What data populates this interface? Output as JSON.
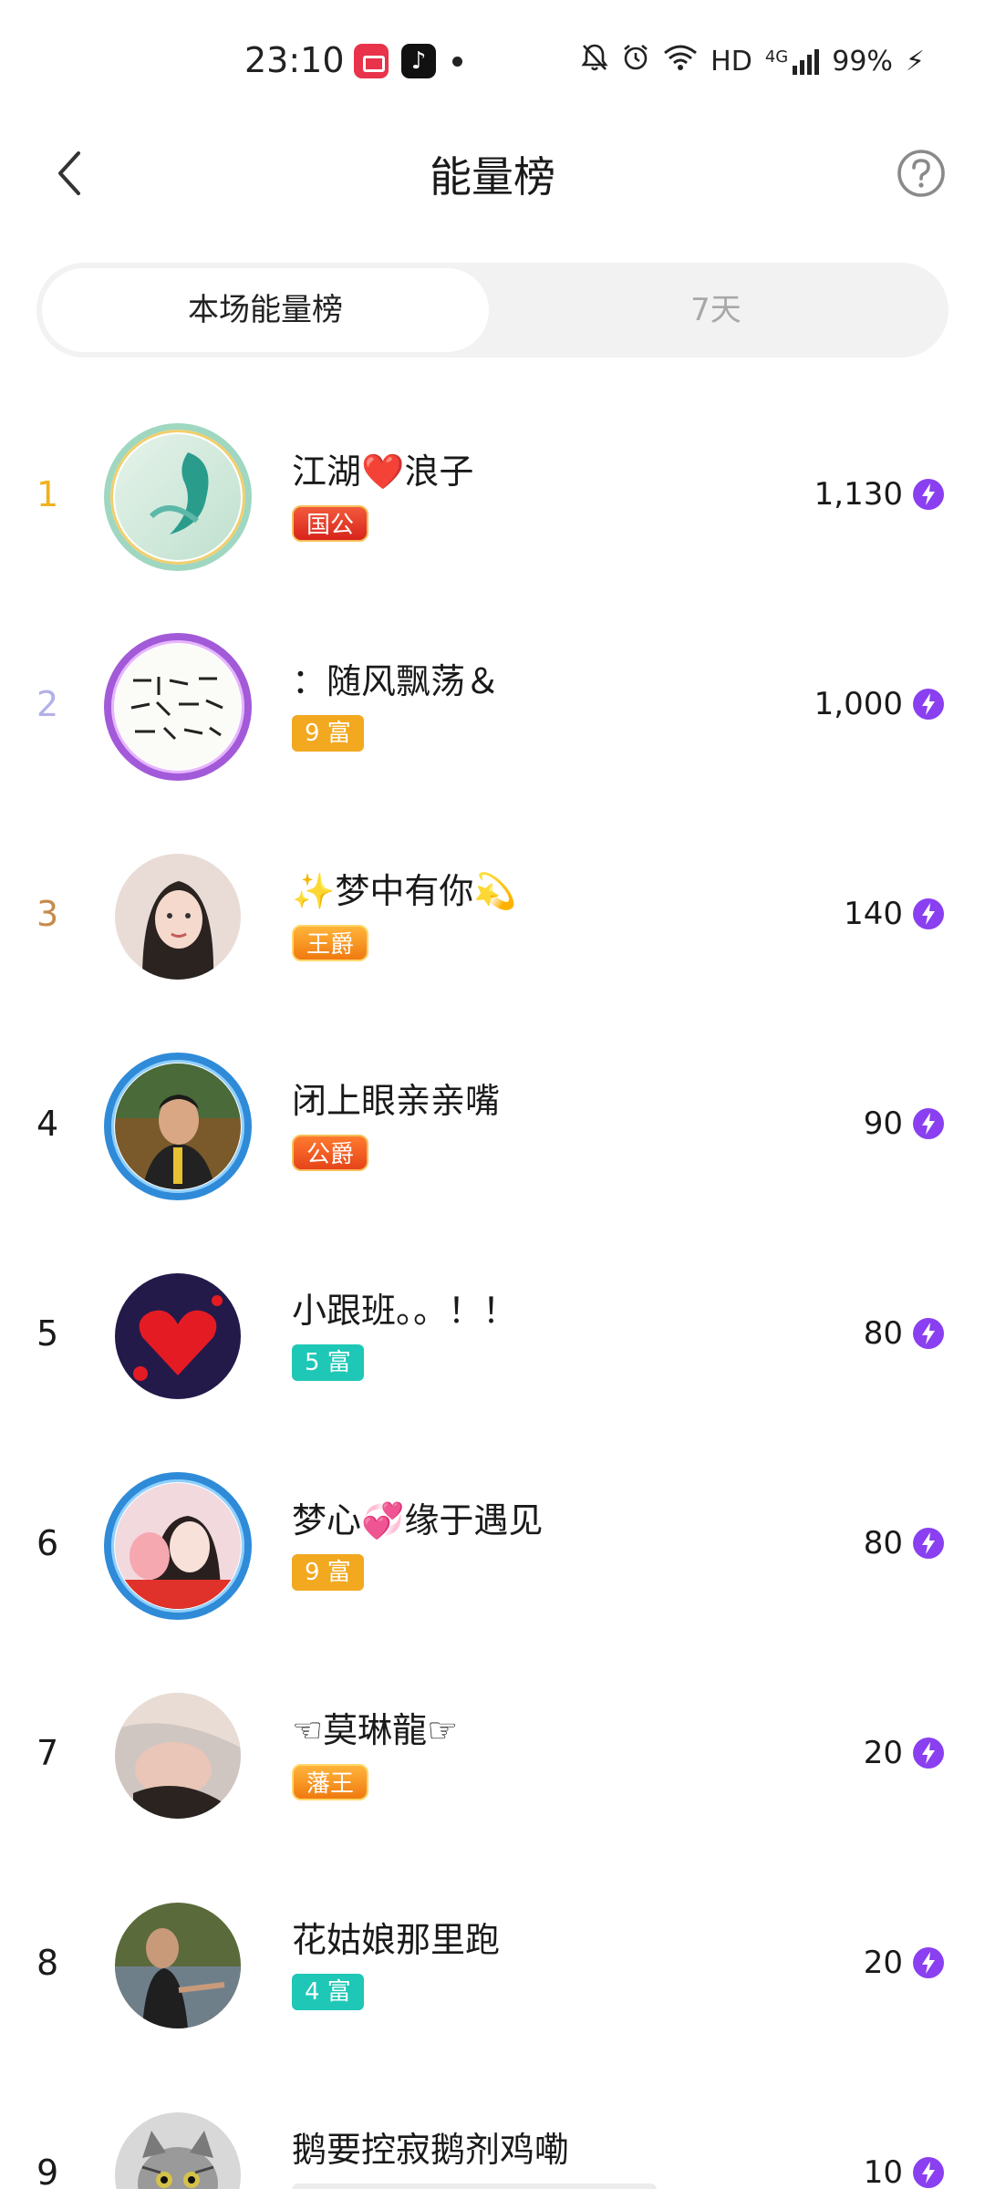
{
  "status_bar": {
    "time": "23:10",
    "network": "HD",
    "signal_label": "4G",
    "battery": "99%",
    "icons": [
      "screen-record-icon",
      "tiktok-icon",
      "notification-dot-icon",
      "mute-icon",
      "alarm-icon",
      "wifi-icon",
      "signal-icon",
      "charging-icon"
    ]
  },
  "header": {
    "title": "能量榜",
    "back_icon": "chevron-left-icon",
    "help_icon": "question-circle-icon"
  },
  "tabs": [
    {
      "label": "本场能量榜",
      "active": true
    },
    {
      "label": "7天",
      "active": false
    }
  ],
  "ranking": [
    {
      "rank": "1",
      "name": "江湖❤️浪子",
      "badge": "国公",
      "score": "1,130"
    },
    {
      "rank": "2",
      "name": "：随风飘荡＆",
      "badge": "9 富",
      "score": "1,000"
    },
    {
      "rank": "3",
      "name": "✨梦中有你💫",
      "badge": "王爵",
      "score": "140"
    },
    {
      "rank": "4",
      "name": "闭上眼亲亲嘴",
      "badge": "公爵",
      "score": "90"
    },
    {
      "rank": "5",
      "name": "小跟班。。！！",
      "badge": "5 富",
      "score": "80"
    },
    {
      "rank": "6",
      "name": "梦心💞缘于遇见",
      "badge": "9 富",
      "score": "80"
    },
    {
      "rank": "7",
      "name": "☜莫琳龍☞",
      "badge": "藩王",
      "score": "20"
    },
    {
      "rank": "8",
      "name": "花姑娘那里跑",
      "badge": "4 富",
      "score": "20"
    },
    {
      "rank": "9",
      "name": "鹅要控寂鹅剂鸡嘞",
      "badge": "",
      "score": "10"
    }
  ],
  "colors": {
    "rank1": "#f2b01e",
    "rank2": "#b3b0e8",
    "rank3": "#c78a4b",
    "energy": "#8a3ff0",
    "badge_rich_orange": "#f2a81f",
    "badge_rich_teal": "#1ec7b6"
  },
  "energy_icon": "lightning-energy-icon"
}
